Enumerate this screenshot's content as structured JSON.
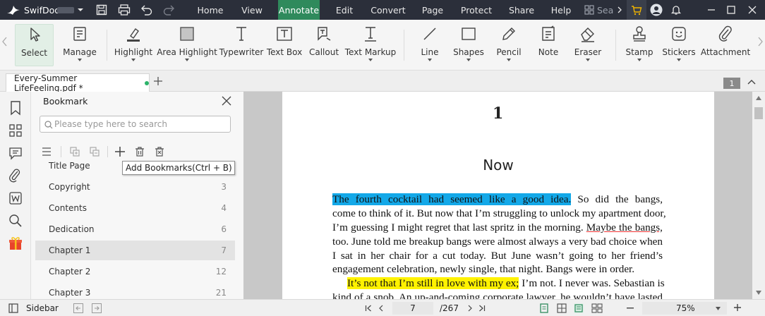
{
  "app": {
    "name": "SwifDoo",
    "menu": [
      "Home",
      "View",
      "Annotate",
      "Edit",
      "Convert",
      "Page",
      "Protect",
      "Share",
      "Help"
    ],
    "active_menu": "Annotate",
    "search_placeholder": "Sea",
    "accent_color": "#2f8a5c"
  },
  "ribbon": {
    "tools": [
      {
        "label": "Select",
        "icon": "cursor-icon"
      },
      {
        "label": "Manage",
        "icon": "manage-icon"
      },
      {
        "label": "Highlight",
        "icon": "highlighter-icon"
      },
      {
        "label": "Area Highlight",
        "icon": "area-highlight-icon"
      },
      {
        "label": "Typewriter",
        "icon": "typewriter-icon"
      },
      {
        "label": "Text Box",
        "icon": "text-box-icon"
      },
      {
        "label": "Callout",
        "icon": "callout-icon"
      },
      {
        "label": "Text Markup",
        "icon": "text-markup-icon"
      },
      {
        "label": "Line",
        "icon": "line-icon"
      },
      {
        "label": "Shapes",
        "icon": "shapes-icon"
      },
      {
        "label": "Pencil",
        "icon": "pencil-icon"
      },
      {
        "label": "Note",
        "icon": "note-icon"
      },
      {
        "label": "Eraser",
        "icon": "eraser-icon"
      },
      {
        "label": "Stamp",
        "icon": "stamp-icon"
      },
      {
        "label": "Stickers",
        "icon": "sticker-icon"
      },
      {
        "label": "Attachment",
        "icon": "paperclip-icon"
      }
    ]
  },
  "tab": {
    "title": "Every-Summer LifeFeeling.pdf *",
    "page_badge": "1"
  },
  "bookmark": {
    "title": "Bookmark",
    "search_placeholder": "Please type here to search",
    "tooltip": "Add Bookmarks(Ctrl + B)",
    "items": [
      {
        "label": "Title Page",
        "page": ""
      },
      {
        "label": "Copyright",
        "page": "3"
      },
      {
        "label": "Contents",
        "page": "4"
      },
      {
        "label": "Dedication",
        "page": "6"
      },
      {
        "label": "Chapter 1",
        "page": "7"
      },
      {
        "label": "Chapter 2",
        "page": "12"
      },
      {
        "label": "Chapter 3",
        "page": "21"
      }
    ],
    "selected": "Chapter 1"
  },
  "document": {
    "chapter_number": "1",
    "chapter_title": "Now",
    "lines": [
      {
        "parts": [
          {
            "text": "The fourth cocktail had seemed like a good idea.",
            "style": "hl-blue"
          },
          {
            "text": " So did the bangs,",
            "style": ""
          }
        ]
      },
      {
        "parts": [
          {
            "text": "come to think of it. But now that I’m struggling to unlock my apartment door,",
            "style": ""
          }
        ]
      },
      {
        "parts": [
          {
            "text": "I’m guessing I might regret that last spritz in the morning. ",
            "style": ""
          },
          {
            "text": "Maybe the bangs,",
            "style": "ul-red"
          }
        ]
      },
      {
        "parts": [
          {
            "text": "too. June told me breakup bangs were almost always a very bad choice when",
            "style": ""
          }
        ]
      },
      {
        "parts": [
          {
            "text": "I sat in her chair for a cut today. But June wasn’t going to her friend’s",
            "style": ""
          }
        ]
      },
      {
        "parts": [
          {
            "text": "engagement celebration, newly single, that night. Bangs were in order.",
            "style": ""
          }
        ]
      },
      {
        "parts": [
          {
            "text": "It’s not that I’m still in love with my ex;",
            "style": "hl-yellow"
          },
          {
            "text": " I’m not. I never was. Sebastian is",
            "style": ""
          }
        ]
      },
      {
        "parts": [
          {
            "text": "kind of a snob. An up-and-coming corporate lawyer, he wouldn’t have lasted",
            "style": ""
          }
        ]
      }
    ]
  },
  "status": {
    "sidebar_label": "Sidebar",
    "current_page": "7",
    "total_pages": "/267",
    "zoom": "75%"
  }
}
